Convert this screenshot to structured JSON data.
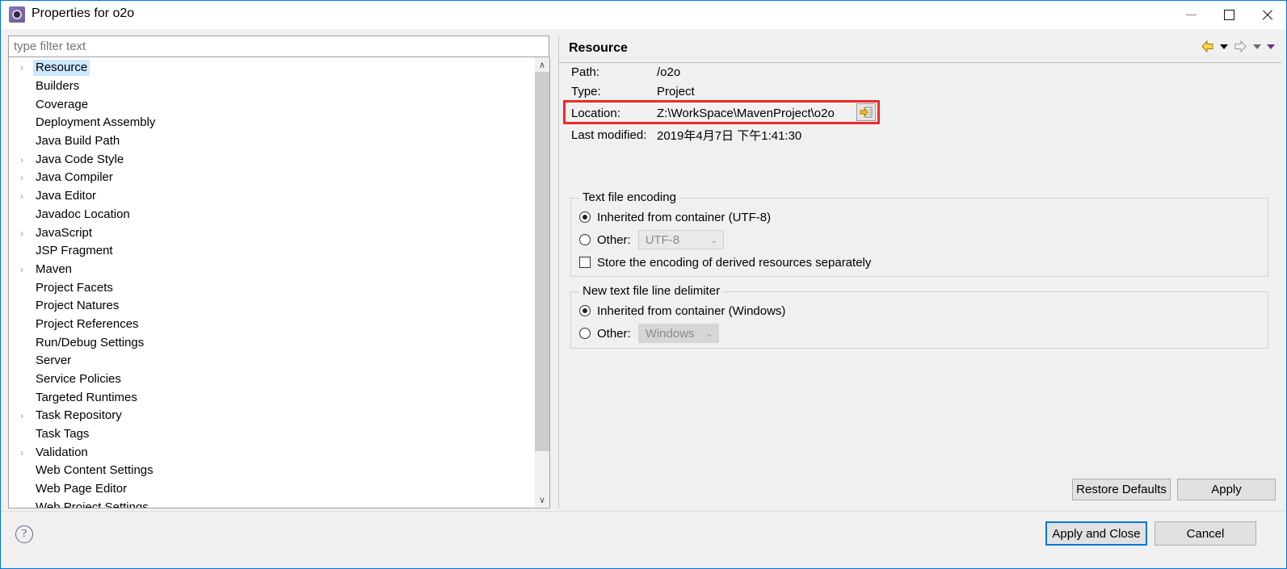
{
  "window": {
    "title": "Properties for o2o",
    "icon": "eclipse-properties-icon",
    "minimize_label": "Minimize",
    "maximize_label": "Maximize",
    "close_label": "Close"
  },
  "filter": {
    "placeholder": "type filter text",
    "value": ""
  },
  "tree": {
    "items": [
      {
        "label": "Resource",
        "expandable": true,
        "selected": true
      },
      {
        "label": "Builders",
        "expandable": false,
        "selected": false
      },
      {
        "label": "Coverage",
        "expandable": false,
        "selected": false
      },
      {
        "label": "Deployment Assembly",
        "expandable": false,
        "selected": false
      },
      {
        "label": "Java Build Path",
        "expandable": false,
        "selected": false
      },
      {
        "label": "Java Code Style",
        "expandable": true,
        "selected": false
      },
      {
        "label": "Java Compiler",
        "expandable": true,
        "selected": false
      },
      {
        "label": "Java Editor",
        "expandable": true,
        "selected": false
      },
      {
        "label": "Javadoc Location",
        "expandable": false,
        "selected": false
      },
      {
        "label": "JavaScript",
        "expandable": true,
        "selected": false
      },
      {
        "label": "JSP Fragment",
        "expandable": false,
        "selected": false
      },
      {
        "label": "Maven",
        "expandable": true,
        "selected": false
      },
      {
        "label": "Project Facets",
        "expandable": false,
        "selected": false
      },
      {
        "label": "Project Natures",
        "expandable": false,
        "selected": false
      },
      {
        "label": "Project References",
        "expandable": false,
        "selected": false
      },
      {
        "label": "Run/Debug Settings",
        "expandable": false,
        "selected": false
      },
      {
        "label": "Server",
        "expandable": false,
        "selected": false
      },
      {
        "label": "Service Policies",
        "expandable": false,
        "selected": false
      },
      {
        "label": "Targeted Runtimes",
        "expandable": false,
        "selected": false
      },
      {
        "label": "Task Repository",
        "expandable": true,
        "selected": false
      },
      {
        "label": "Task Tags",
        "expandable": false,
        "selected": false
      },
      {
        "label": "Validation",
        "expandable": true,
        "selected": false
      },
      {
        "label": "Web Content Settings",
        "expandable": false,
        "selected": false
      },
      {
        "label": "Web Page Editor",
        "expandable": false,
        "selected": false
      },
      {
        "label": "Web Project Settings",
        "expandable": false,
        "selected": false
      }
    ],
    "expand_arrow": "›",
    "scroll_up": "∧",
    "scroll_down": "∨"
  },
  "panel": {
    "title": "Resource",
    "nav": {
      "back_label": "Back",
      "back_menu_label": "Back history",
      "forward_label": "Forward",
      "forward_menu_label": "Forward history",
      "view_menu_label": "View menu"
    },
    "properties": [
      {
        "key": "Path:",
        "value": "/o2o",
        "highlighted": false
      },
      {
        "key": "Type:",
        "value": "Project",
        "highlighted": false
      },
      {
        "key": "Location:",
        "value": "Z:\\WorkSpace\\MavenProject\\o2o",
        "highlighted": true
      },
      {
        "key": "Last modified:",
        "value": "2019年4月7日 下午1:41:30",
        "highlighted": false
      }
    ],
    "browse_button_label": "Browse location",
    "highlight_color": "#ef2929",
    "encoding_group": {
      "legend": "Text file encoding",
      "inherited_label": "Inherited from container (UTF-8)",
      "inherited_checked": true,
      "other_label": "Other:",
      "other_checked": false,
      "other_value": "UTF-8",
      "store_derived_label": "Store the encoding of derived resources separately",
      "store_derived_checked": false
    },
    "delimiter_group": {
      "legend": "New text file line delimiter",
      "inherited_label": "Inherited from container (Windows)",
      "inherited_checked": true,
      "other_label": "Other:",
      "other_checked": false,
      "other_value": "Windows"
    },
    "restore_defaults_label": "Restore Defaults",
    "apply_label": "Apply"
  },
  "footer": {
    "help_label": "?",
    "apply_and_close_label": "Apply and Close",
    "cancel_label": "Cancel"
  }
}
